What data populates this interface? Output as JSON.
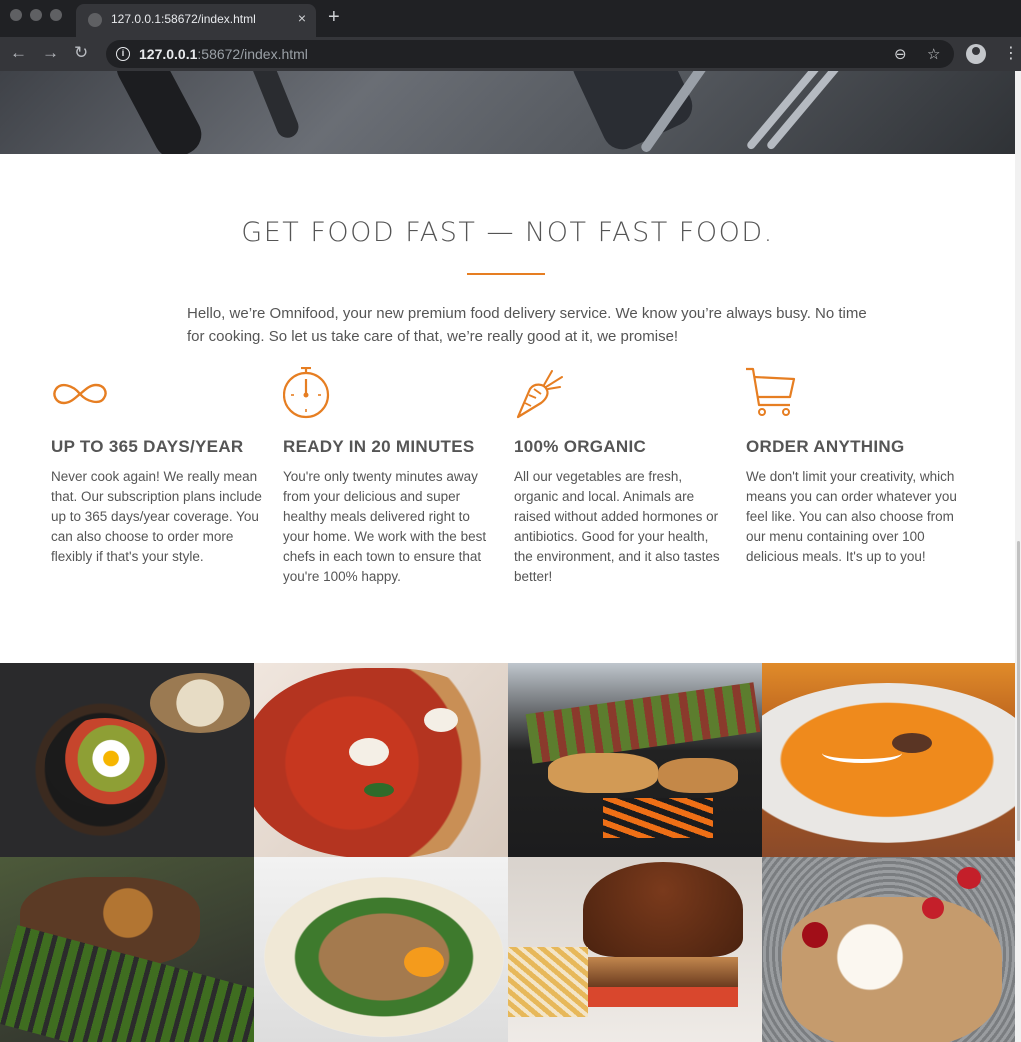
{
  "browser": {
    "tab_title": "127.0.0.1:58672/index.html",
    "tab_close": "×",
    "new_tab": "+",
    "url_host": "127.0.0.1",
    "url_rest": ":58672/index.html",
    "back": "←",
    "forward": "→",
    "reload": "↻",
    "zoom_icon": "⊖",
    "star_icon": "☆",
    "menu_icon": "⋮"
  },
  "section": {
    "title": "GET FOOD FAST — NOT FAST FOOD.",
    "intro": "Hello, we’re Omnifood, your new premium food delivery service. We know you’re always busy. No time for cooking. So let us take care of that, we’re really good at it, we promise!",
    "accent_color": "#e67e22"
  },
  "features": [
    {
      "icon": "infinity-icon",
      "title": "UP TO 365 DAYS/YEAR",
      "text": "Never cook again! We really mean that. Our subscription plans include up to 365 days/year coverage. You can also choose to order more flexibly if that's your style."
    },
    {
      "icon": "stopwatch-icon",
      "title": "READY IN 20 MINUTES",
      "text": "You're only twenty minutes away from your delicious and super healthy meals delivered right to your home. We work with the best chefs in each town to ensure that you're 100% happy."
    },
    {
      "icon": "carrot-icon",
      "title": "100% ORGANIC",
      "text": "All our vegetables are fresh, organic and local. Animals are raised without added hormones or antibiotics. Good for your health, the environment, and it also tastes better!"
    },
    {
      "icon": "cart-icon",
      "title": "ORDER ANYTHING",
      "text": "We don't limit your creativity, which means you can order whatever you feel like. You can also choose from our menu containing over 100 delicious meals. It's up to you!"
    }
  ]
}
